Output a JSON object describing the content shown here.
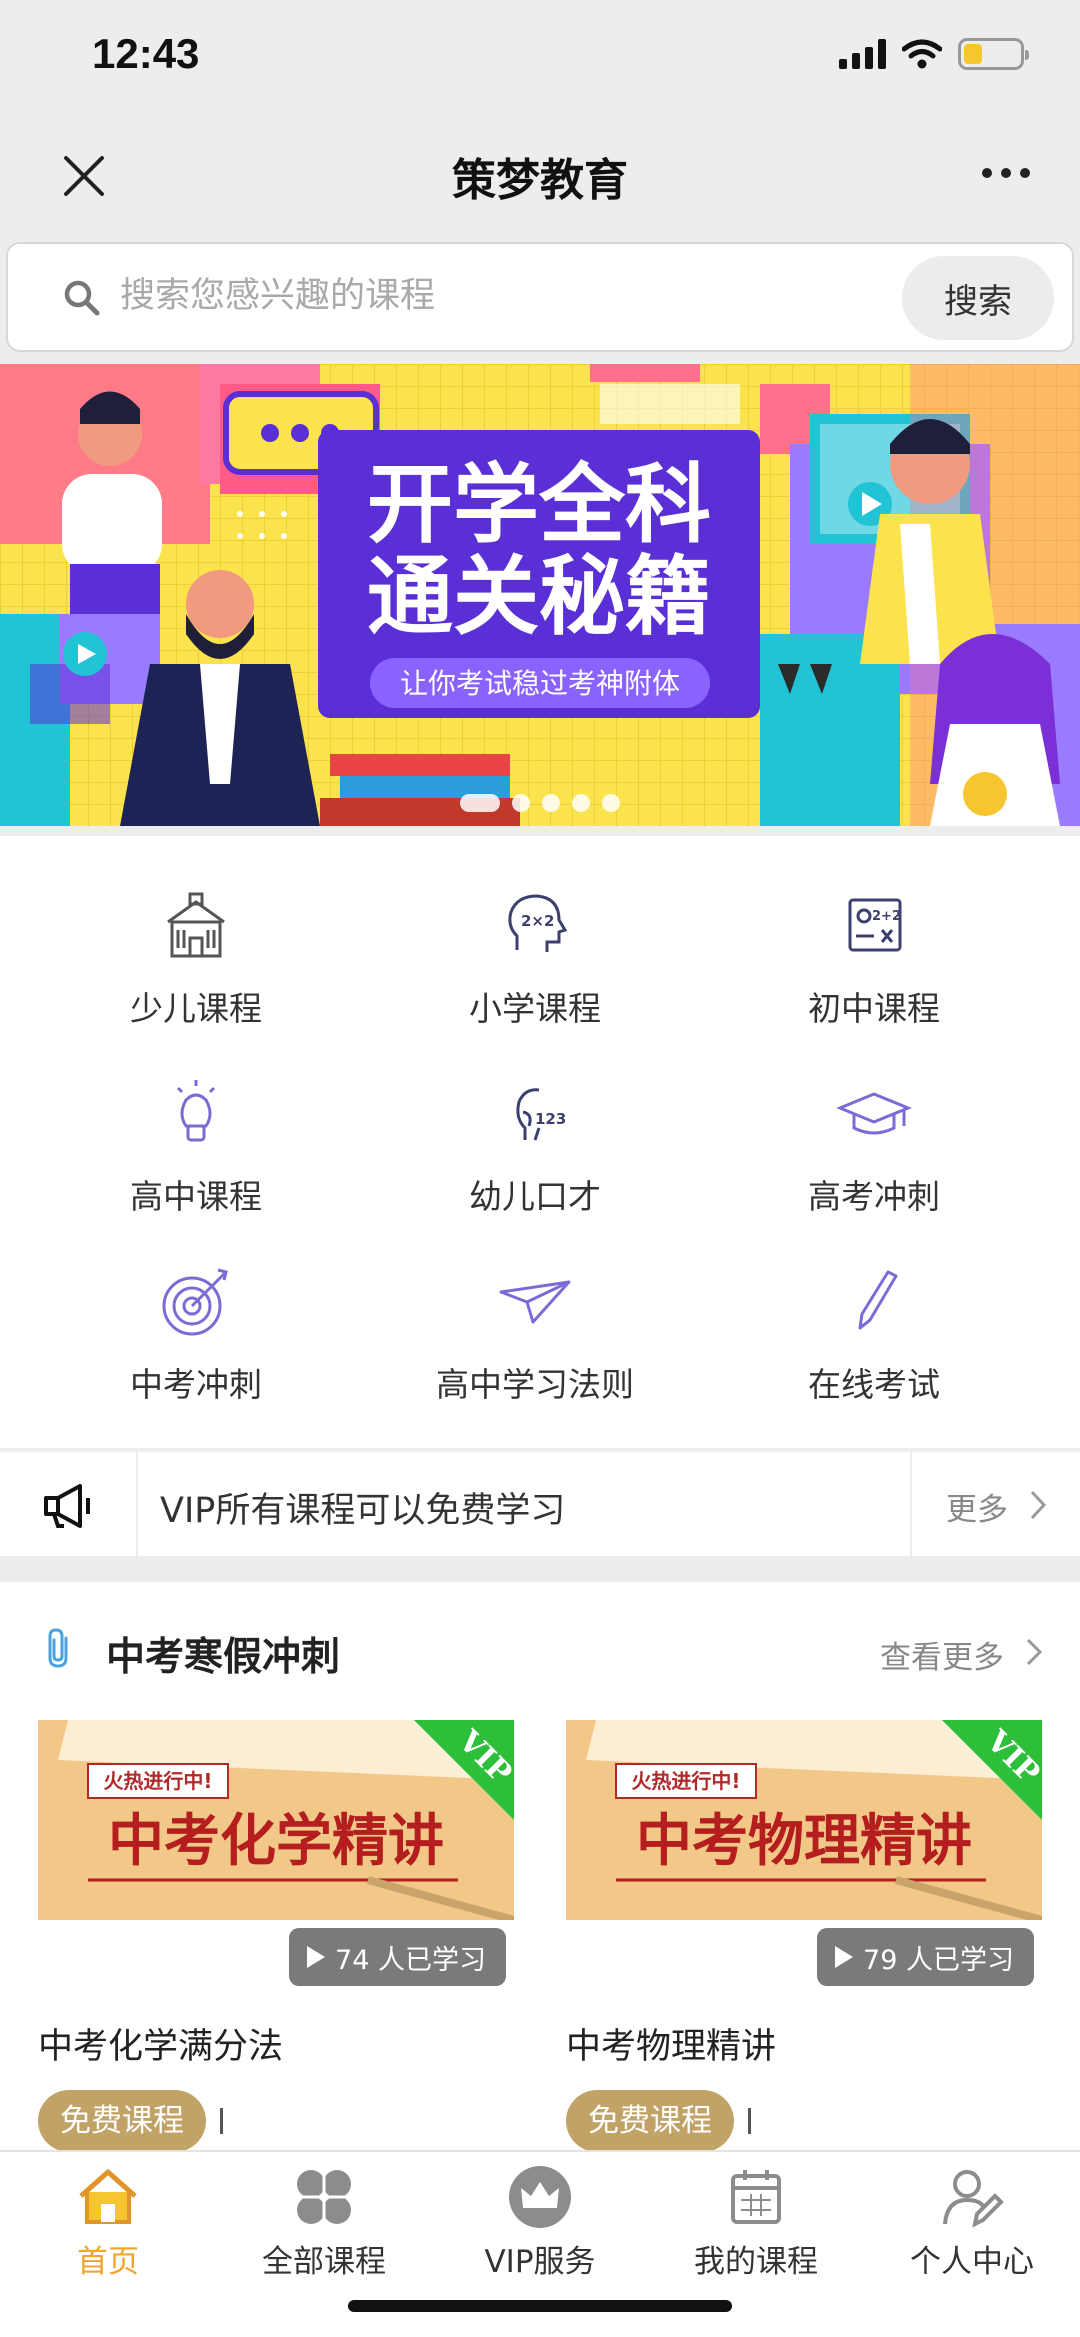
{
  "status": {
    "time": "12:43"
  },
  "nav": {
    "title": "策梦教育"
  },
  "search": {
    "placeholder": "搜索您感兴趣的课程",
    "button": "搜索"
  },
  "banner": {
    "title_line1": "开学全科",
    "title_line2": "通关秘籍",
    "subtitle": "让你考试稳过考神附体",
    "dots": 5,
    "active_dot": 0
  },
  "categories": [
    {
      "label": "少儿课程",
      "icon": "school-building-icon"
    },
    {
      "label": "小学课程",
      "icon": "head-math-icon"
    },
    {
      "label": "初中课程",
      "icon": "formula-board-icon"
    },
    {
      "label": "高中课程",
      "icon": "lightbulb-icon"
    },
    {
      "label": "幼儿口才",
      "icon": "speaking-head-icon"
    },
    {
      "label": "高考冲刺",
      "icon": "graduation-cap-icon"
    },
    {
      "label": "中考冲刺",
      "icon": "target-icon"
    },
    {
      "label": "高中学习法则",
      "icon": "paper-plane-icon"
    },
    {
      "label": "在线考试",
      "icon": "pen-icon"
    }
  ],
  "notice": {
    "text": "VIP所有课程可以免费学习",
    "more": "更多"
  },
  "section": {
    "title": "中考寒假冲刺",
    "more": "查看更多",
    "courses": [
      {
        "thumb_title": "中考化学精讲",
        "thumb_tag": "火热进行中!",
        "corner": "VIP",
        "count": "74 人已学习",
        "name": "中考化学满分法",
        "tag": "免费课程"
      },
      {
        "thumb_title": "中考物理精讲",
        "thumb_tag": "火热进行中!",
        "corner": "VIP",
        "count": "79 人已学习",
        "name": "中考物理精讲",
        "tag": "免费课程"
      }
    ]
  },
  "tabs": [
    {
      "label": "首页",
      "icon": "home-icon",
      "active": true
    },
    {
      "label": "全部课程",
      "icon": "clover-grid-icon",
      "active": false
    },
    {
      "label": "VIP服务",
      "icon": "crown-icon",
      "active": false
    },
    {
      "label": "我的课程",
      "icon": "calendar-icon",
      "active": false
    },
    {
      "label": "个人中心",
      "icon": "user-edit-icon",
      "active": false
    }
  ],
  "colors": {
    "accent": "#f0a52c",
    "tag_gold": "#c2a367",
    "banner_purple": "#5b2fd6",
    "banner_yellow": "#fbe34d"
  }
}
